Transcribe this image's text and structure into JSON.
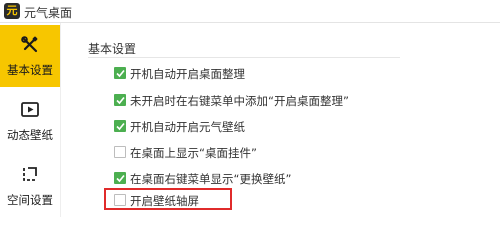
{
  "app": {
    "logo_text": "元",
    "title": "元气桌面"
  },
  "sidebar": {
    "items": [
      {
        "label": "基本设置",
        "icon": "tools-icon",
        "active": true
      },
      {
        "label": "动态壁纸",
        "icon": "play-icon",
        "active": false
      },
      {
        "label": "空间设置",
        "icon": "space-icon",
        "active": false
      }
    ]
  },
  "main": {
    "section_title": "基本设置",
    "options": [
      {
        "label": "开机自动开启桌面整理",
        "checked": true
      },
      {
        "label": "未开启时在右键菜单中添加“开启桌面整理”",
        "checked": true
      },
      {
        "label": "开机自动开启元气壁纸",
        "checked": true
      },
      {
        "label": "在桌面上显示“桌面挂件”",
        "checked": false
      },
      {
        "label": "在桌面右键菜单显示“更换壁纸”",
        "checked": true
      },
      {
        "label": "开启壁纸轴屏",
        "checked": false
      }
    ]
  },
  "colors": {
    "accent": "#f7c600",
    "check": "#4caf50",
    "highlight": "#e02b2b"
  }
}
